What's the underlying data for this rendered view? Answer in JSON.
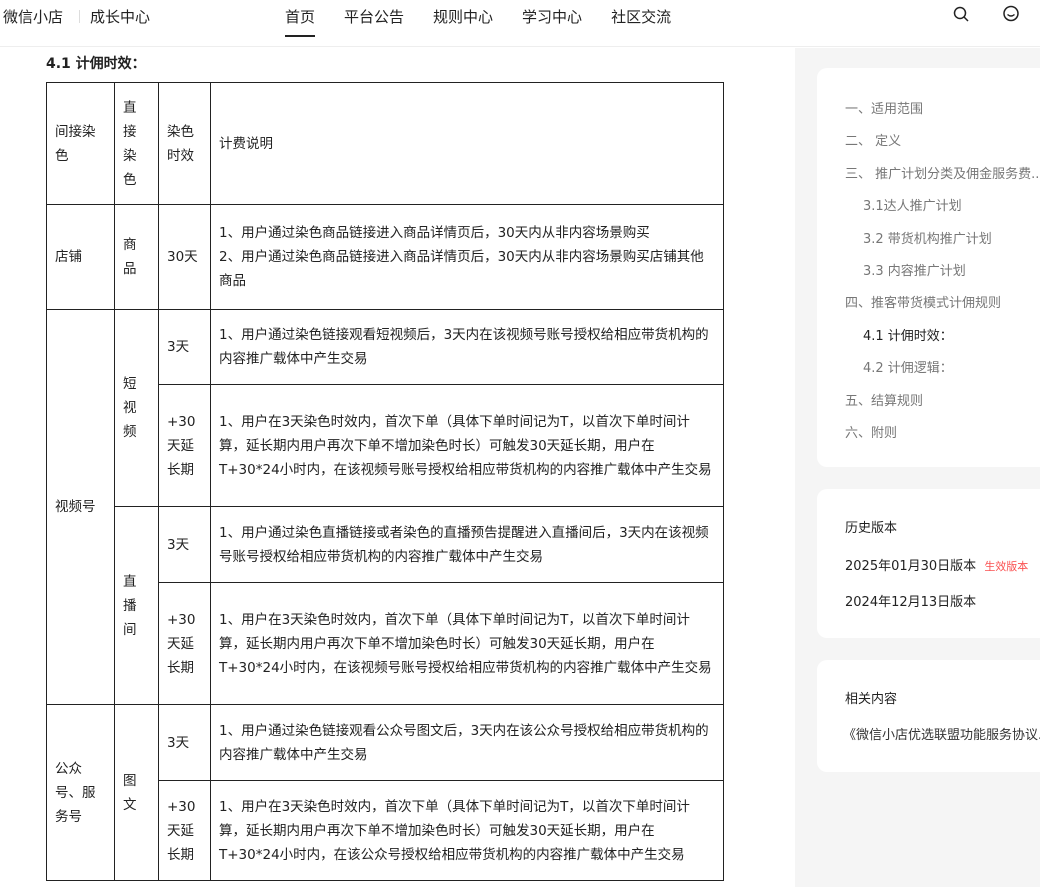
{
  "header": {
    "brand": "微信小店",
    "sub": "成长中心",
    "nav": [
      "首页",
      "平台公告",
      "规则中心",
      "学习中心",
      "社区交流"
    ]
  },
  "section_title": "4.1 计佣时效：",
  "table": {
    "headers": [
      "间接染色",
      "直接染色",
      "染色时效",
      "计费说明"
    ],
    "shop": {
      "indirect": "店铺",
      "direct": "商品",
      "time": "30天",
      "desc": [
        "1、用户通过染色商品链接进入商品详情页后，30天内从非内容场景购买",
        "2、用户通过染色商品链接进入商品详情页后，30天内从非内容场景购买店铺其他商品"
      ]
    },
    "channels": {
      "indirect": "视频号",
      "short_video": {
        "direct": "短视频",
        "rows": [
          {
            "time": "3天",
            "desc": "1、用户通过染色链接观看短视频后，3天内在该视频号账号授权给相应带货机构的内容推广载体中产生交易"
          },
          {
            "time": "+30天延长期",
            "desc": "1、用户在3天染色时效内，首次下单（具体下单时间记为T，以首次下单时间计算，延长期内用户再次下单不增加染色时长）可触发30天延长期，用户在T+30*24小时内，在该视频号账号授权给相应带货机构的内容推广载体中产生交易"
          }
        ]
      },
      "live": {
        "direct": "直播间",
        "rows": [
          {
            "time": "3天",
            "desc": "1、用户通过染色直播链接或者染色的直播预告提醒进入直播间后，3天内在该视频号账号授权给相应带货机构的内容推广载体中产生交易"
          },
          {
            "time": "+30天延长期",
            "desc": "1、用户在3天染色时效内，首次下单（具体下单时间记为T，以首次下单时间计算，延长期内用户再次下单不增加染色时长）可触发30天延长期，用户在T+30*24小时内，在该视频号账号授权给相应带货机构的内容推广载体中产生交易"
          }
        ]
      }
    },
    "official": {
      "indirect": "公众号、服务号",
      "direct": "图文",
      "rows": [
        {
          "time": "3天",
          "desc": "1、用户通过染色链接观看公众号图文后，3天内在该公众号授权给相应带货机构的内容推广载体中产生交易"
        },
        {
          "time": "+30天延长期",
          "desc": "1、用户在3天染色时效内，首次下单（具体下单时间记为T，以首次下单时间计算，延长期内用户再次下单不增加染色时长）可触发30天延长期，用户在T+30*24小时内，在该公众号授权给相应带货机构的内容推广载体中产生交易"
        }
      ]
    }
  },
  "toc": [
    "一、适用范围",
    "二、 定义",
    "三、 推广计划分类及佣金服务费...",
    "3.1达人推广计划",
    "3.2 带货机构推广计划",
    "3.3 内容推广计划",
    "四、推客带货模式计佣规则",
    "4.1 计佣时效：",
    "4.2 计佣逻辑：",
    "五、结算规则",
    "六、附则"
  ],
  "history": {
    "title": "历史版本",
    "versions": [
      "2025年01月30日版本",
      "2024年12月13日版本"
    ],
    "badge": "生效版本",
    "badge_color": "#fa5151"
  },
  "related": {
    "title": "相关内容",
    "items": [
      "《微信小店优选联盟功能服务协议..."
    ]
  }
}
